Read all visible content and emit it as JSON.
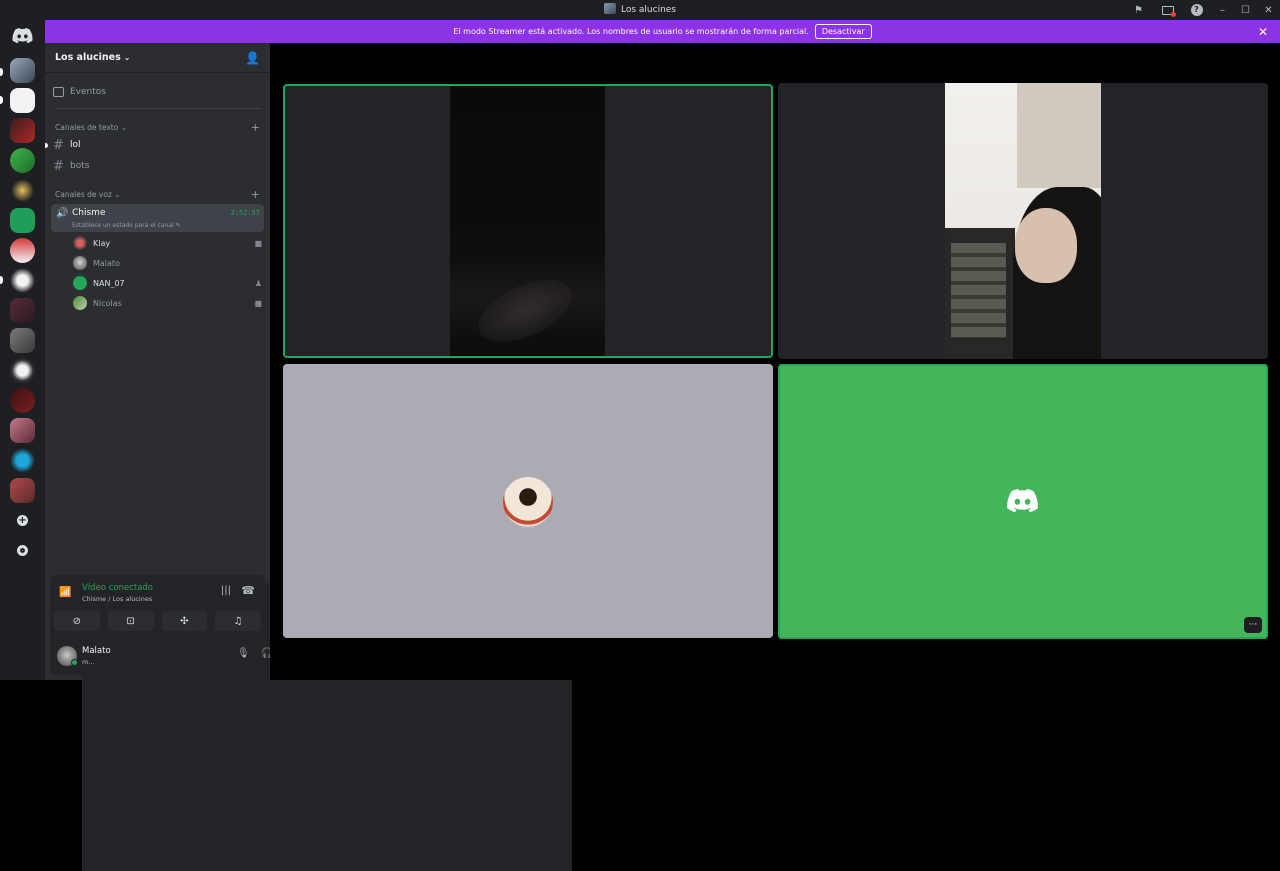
{
  "window": {
    "title": "Los alucines"
  },
  "banner": {
    "text": "El modo Streamer está activado. Los nombres de usuario se mostrarán de forma parcial.",
    "button": "Desactivar"
  },
  "guild": {
    "name": "Los alucines",
    "events_label": "Eventos",
    "text_category": "Canales de texto",
    "text_channels": [
      "lol",
      "bots"
    ],
    "voice_category": "Canales de voz",
    "voice_channel": {
      "name": "Chisme",
      "timer": "2:52:57",
      "status": "Establece un estado para el canal"
    },
    "voice_users": [
      "Klay",
      "Malato",
      "NAN_07",
      "Nicolas"
    ]
  },
  "rtc": {
    "status": "Vídeo conectado",
    "location": "Chisme / Los alucines"
  },
  "user": {
    "name": "Malato",
    "tag": "m..."
  },
  "colors": {
    "accent_green": "#23a55a",
    "banner_purple": "#8c33e7",
    "tile_green": "#43b55a"
  }
}
